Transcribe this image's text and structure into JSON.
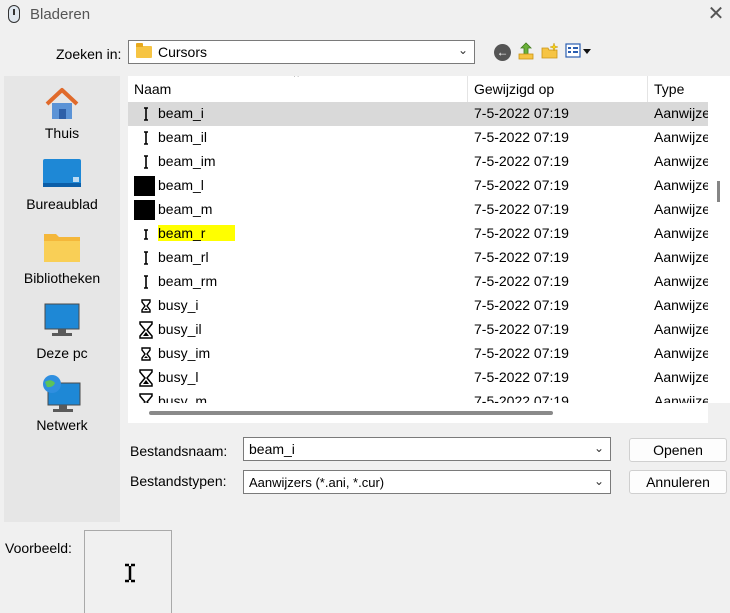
{
  "window": {
    "title": "Bladeren",
    "close_glyph": "✕"
  },
  "lookin": {
    "label": "Zoeken in:",
    "value": "Cursors"
  },
  "toolbar": {
    "back": "back-arrow-icon",
    "up": "up-one-level-icon",
    "new_folder": "new-folder-icon",
    "view": "view-menu-icon"
  },
  "places": [
    {
      "label": "Thuis",
      "icon": "home-icon"
    },
    {
      "label": "Bureaublad",
      "icon": "desktop-icon"
    },
    {
      "label": "Bibliotheken",
      "icon": "libraries-icon"
    },
    {
      "label": "Deze pc",
      "icon": "this-pc-icon"
    },
    {
      "label": "Netwerk",
      "icon": "network-icon"
    }
  ],
  "columns": {
    "name": "Naam",
    "modified": "Gewijzigd op",
    "type": "Type",
    "sort_glyph": "^"
  },
  "files": [
    {
      "name": "beam_i",
      "date": "7-5-2022 07:19",
      "type": "Aanwijzer",
      "icon": "ibeam",
      "selected": true
    },
    {
      "name": "beam_il",
      "date": "7-5-2022 07:19",
      "type": "Aanwijzer",
      "icon": "ibeam"
    },
    {
      "name": "beam_im",
      "date": "7-5-2022 07:19",
      "type": "Aanwijzer",
      "icon": "ibeam"
    },
    {
      "name": "beam_l",
      "date": "7-5-2022 07:19",
      "type": "Aanwijzer",
      "icon": "black"
    },
    {
      "name": "beam_m",
      "date": "7-5-2022 07:19",
      "type": "Aanwijzer",
      "icon": "black"
    },
    {
      "name": "beam_r",
      "date": "7-5-2022 07:19",
      "type": "Aanwijzer",
      "icon": "ibeam-small",
      "highlighted": true
    },
    {
      "name": "beam_rl",
      "date": "7-5-2022 07:19",
      "type": "Aanwijzer",
      "icon": "ibeam"
    },
    {
      "name": "beam_rm",
      "date": "7-5-2022 07:19",
      "type": "Aanwijzer",
      "icon": "ibeam"
    },
    {
      "name": "busy_i",
      "date": "7-5-2022 07:19",
      "type": "Aanwijzer",
      "icon": "hourglass-small"
    },
    {
      "name": "busy_il",
      "date": "7-5-2022 07:19",
      "type": "Aanwijzer",
      "icon": "hourglass"
    },
    {
      "name": "busy_im",
      "date": "7-5-2022 07:19",
      "type": "Aanwijzer",
      "icon": "hourglass-small"
    },
    {
      "name": "busy_l",
      "date": "7-5-2022 07:19",
      "type": "Aanwijzer",
      "icon": "hourglass"
    },
    {
      "name": "busy_m",
      "date": "7-5-2022 07:19",
      "type": "Aanwijzer",
      "icon": "hourglass"
    }
  ],
  "filename": {
    "label": "Bestandsnaam:",
    "value": "beam_i"
  },
  "filetype": {
    "label": "Bestandstypen:",
    "value": "Aanwijzers (*.ani, *.cur)"
  },
  "buttons": {
    "open": "Openen",
    "cancel": "Annuleren"
  },
  "preview": {
    "label": "Voorbeeld:"
  },
  "colors": {
    "selection": "#d9d9d9",
    "highlight": "#ffff00"
  }
}
